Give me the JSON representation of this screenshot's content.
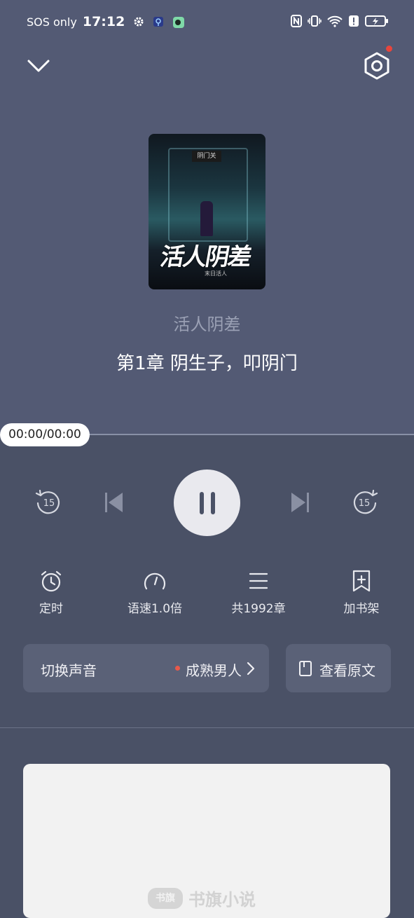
{
  "status_bar": {
    "carrier": "SOS only",
    "time": "17:12"
  },
  "player": {
    "book_title": "活人阴差",
    "chapter_title": "第1章 阴生子，叩阴门",
    "time_display": "00:00/00:00",
    "progress": 0.0,
    "skip_back_seconds": "15",
    "skip_forward_seconds": "15",
    "cover": {
      "title": "活人阴差",
      "plaque": "阴门关",
      "author": "末日活人"
    }
  },
  "functions": {
    "timer_label": "定时",
    "speed_label": "语速1.0倍",
    "chapters_label": "共1992章",
    "bookshelf_label": "加书架"
  },
  "voice": {
    "label": "切换声音",
    "current": "成熟男人"
  },
  "view_text": {
    "label": "查看原文"
  },
  "ad": {
    "brand": "书旗小说",
    "logo_text": "书旗"
  },
  "colors": {
    "background": "#4a5166",
    "header_bg": "#535a74",
    "card_bg": "#5a6177",
    "accent_red": "#e8453c"
  }
}
